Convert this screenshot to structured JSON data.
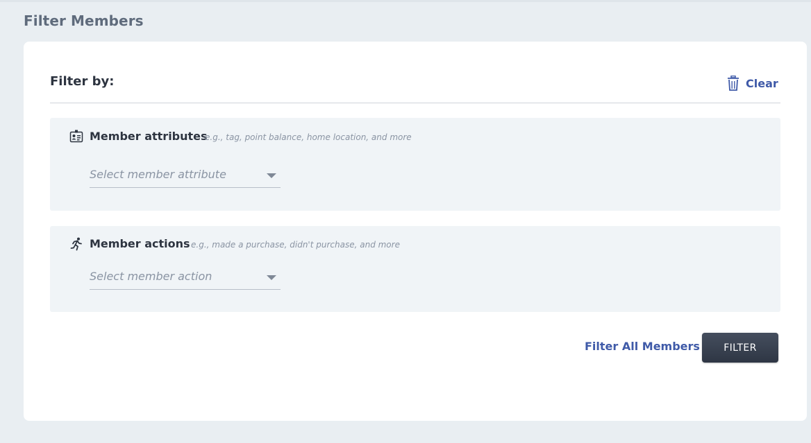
{
  "page": {
    "title": "Filter Members"
  },
  "filter_card": {
    "heading": "Filter by:",
    "clear_label": "Clear"
  },
  "attributes_panel": {
    "icon": "id-badge-icon",
    "title": "Member attributes",
    "hint": "e.g., tag, point balance, home location, and more",
    "select_placeholder": "Select member attribute"
  },
  "actions_panel": {
    "icon": "running-person-icon",
    "title": "Member actions",
    "hint": "e.g., made a purchase, didn't purchase, and more",
    "select_placeholder": "Select member action"
  },
  "footer": {
    "filter_all_label": "Filter All Members",
    "filter_button_label": "FILTER"
  },
  "colors": {
    "accent": "#3f5aa8",
    "button_dark": "#353d4b",
    "panel_bg": "#f0f4f7",
    "page_bg": "#e9eef2"
  }
}
